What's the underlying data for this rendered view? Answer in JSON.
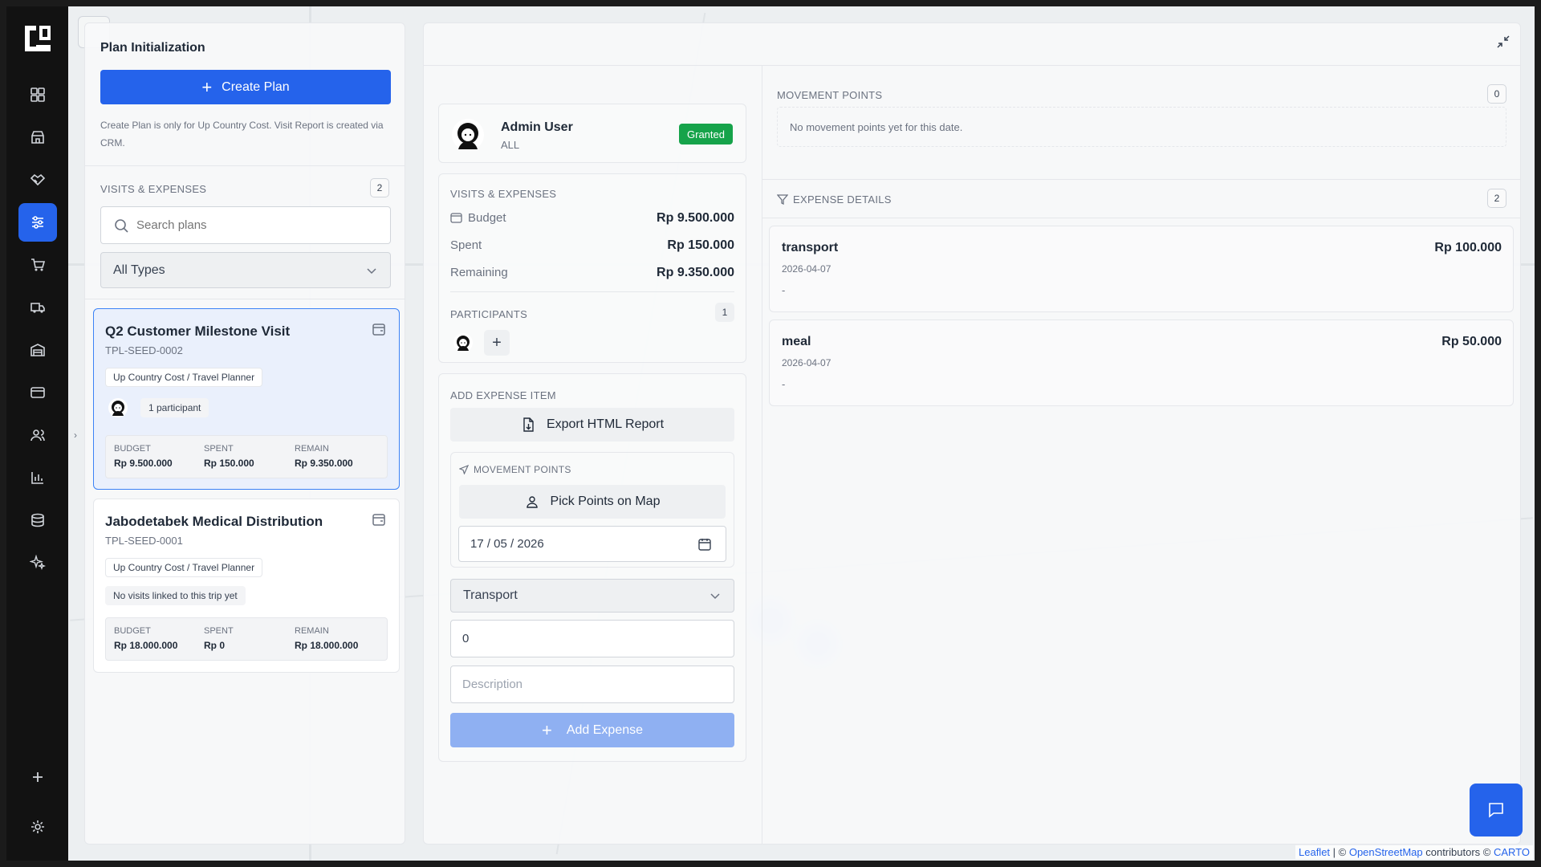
{
  "sidebar": {
    "items": [
      {
        "icon": "grid-icon"
      },
      {
        "icon": "store-icon"
      },
      {
        "icon": "handshake-icon"
      },
      {
        "icon": "route-settings-icon",
        "active": true
      },
      {
        "icon": "cart-icon"
      },
      {
        "icon": "truck-icon"
      },
      {
        "icon": "warehouse-icon"
      },
      {
        "icon": "credit-card-icon"
      },
      {
        "icon": "users-icon"
      },
      {
        "icon": "bar-chart-icon"
      },
      {
        "icon": "database-icon"
      },
      {
        "icon": "sparkle-icon"
      }
    ]
  },
  "left_panel": {
    "title": "Plan Initialization",
    "create_button": "Create Plan",
    "note": "Create Plan is only for Up Country Cost. Visit Report is created via CRM.",
    "section_label": "VISITS & EXPENSES",
    "section_count": "2",
    "search_placeholder": "Search plans",
    "type_filter": "All Types",
    "plans": [
      {
        "name": "Q2 Customer Milestone Visit",
        "code": "TPL-SEED-0002",
        "tag": "Up Country Cost / Travel Planner",
        "participants": "1 participant",
        "budget_label": "BUDGET",
        "budget": "Rp 9.500.000",
        "spent_label": "SPENT",
        "spent": "Rp 150.000",
        "remain_label": "REMAIN",
        "remain": "Rp 9.350.000"
      },
      {
        "name": "Jabodetabek Medical Distribution",
        "code": "TPL-SEED-0001",
        "tag": "Up Country Cost / Travel Planner",
        "visits_note": "No visits linked to this trip yet",
        "budget_label": "BUDGET",
        "budget": "Rp 18.000.000",
        "spent_label": "SPENT",
        "spent": "Rp 0",
        "remain_label": "REMAIN",
        "remain": "Rp 18.000.000"
      }
    ]
  },
  "detail": {
    "user": {
      "name": "Admin User",
      "role": "ALL",
      "status": "Granted"
    },
    "summary_label": "VISITS & EXPENSES",
    "budget_label": "Budget",
    "budget": "Rp 9.500.000",
    "spent_label": "Spent",
    "spent": "Rp 150.000",
    "remaining_label": "Remaining",
    "remaining": "Rp 9.350.000",
    "participants_label": "PARTICIPANTS",
    "participants_count": "1",
    "add_expense_label": "ADD EXPENSE ITEM",
    "export_button": "Export HTML Report",
    "movement_label": "MOVEMENT POINTS",
    "pick_points_button": "Pick Points on Map",
    "date_value": "17 / 05 / 2026",
    "expense_type": "Transport",
    "amount_value": "0",
    "description_placeholder": "Description",
    "add_expense_button": "Add Expense"
  },
  "right": {
    "movement_label": "MOVEMENT POINTS",
    "movement_count": "0",
    "movement_empty": "No movement points yet for this date.",
    "expense_label": "EXPENSE DETAILS",
    "expense_count": "2",
    "expenses": [
      {
        "type": "transport",
        "date": "2026-04-07",
        "note": "-",
        "amount": "Rp 100.000"
      },
      {
        "type": "meal",
        "date": "2026-04-07",
        "note": "-",
        "amount": "Rp 50.000"
      }
    ]
  },
  "attribution": {
    "leaflet": "Leaflet",
    "sep": " | © ",
    "osm": "OpenStreetMap",
    "contrib": " contributors © ",
    "carto": "CARTO"
  },
  "colors": {
    "accent": "#2563eb",
    "granted": "#16a34a",
    "rail": "#121212"
  }
}
